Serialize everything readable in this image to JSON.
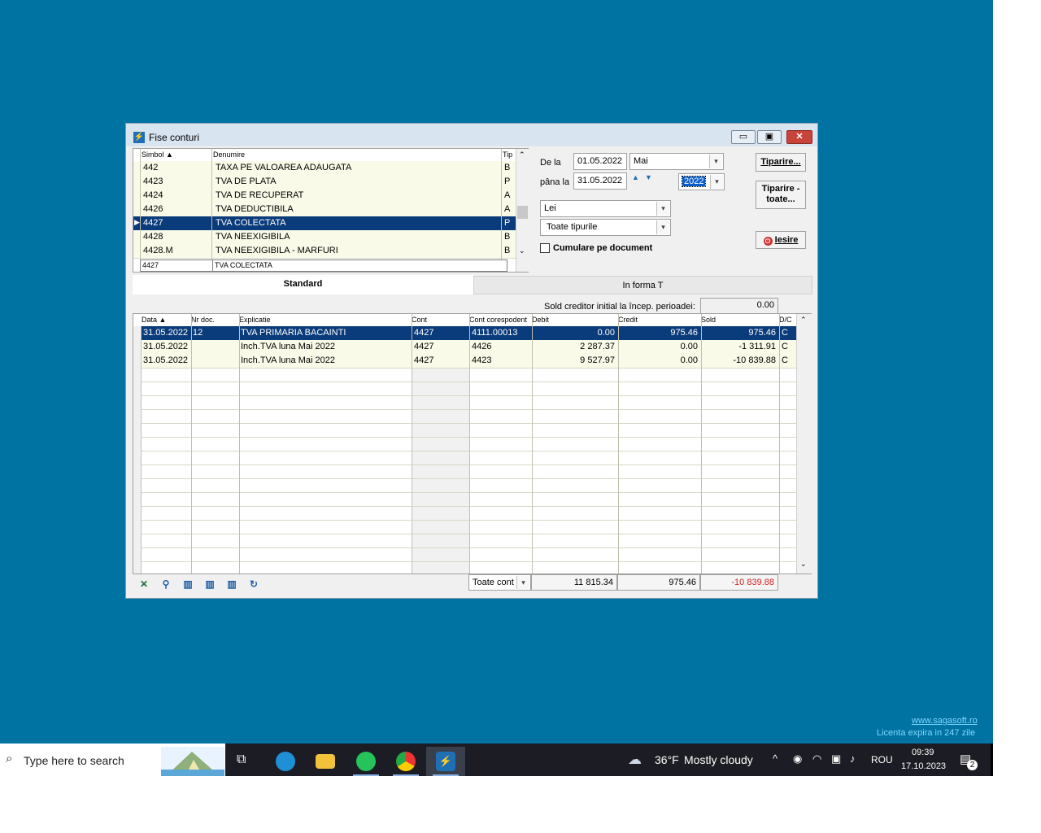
{
  "window": {
    "title": "Fise conturi",
    "minimize_label": "▭",
    "maximize_label": "▣",
    "close_label": "✕"
  },
  "accounts": {
    "headers": {
      "simbol": "Simbol",
      "denumire": "Denumire",
      "tip": "Tip"
    },
    "rows": [
      {
        "simbol": "442",
        "denumire": "TAXA PE VALOAREA ADAUGATA",
        "tip": "B"
      },
      {
        "simbol": "4423",
        "denumire": "TVA DE PLATA",
        "tip": "P"
      },
      {
        "simbol": "4424",
        "denumire": "TVA DE RECUPERAT",
        "tip": "A"
      },
      {
        "simbol": "4426",
        "denumire": "TVA DEDUCTIBILA",
        "tip": "A"
      },
      {
        "simbol": "4427",
        "denumire": "TVA COLECTATA",
        "tip": "P"
      },
      {
        "simbol": "4428",
        "denumire": "TVA NEEXIGIBILA",
        "tip": "B"
      },
      {
        "simbol": "4428.M",
        "denumire": "TVA NEEXIGIBILA - MARFURI",
        "tip": "B"
      }
    ],
    "selected_index": 4,
    "filter": {
      "simbol": "4427",
      "denumire": "TVA COLECTATA"
    }
  },
  "period": {
    "from_label": "De la",
    "from_date": "01.05.2022",
    "month": "Mai",
    "to_label": "pâna la",
    "to_date": "31.05.2022",
    "year": "2022"
  },
  "currency": "Lei",
  "types": "Toate tipurile",
  "cumulare_label": "Cumulare pe document",
  "buttons": {
    "tiparire": "Tiparire...",
    "tiparire_toate_1": "Tiparire -",
    "tiparire_toate_2": "toate...",
    "iesire": "Iesire"
  },
  "tabs": {
    "standard": "Standard",
    "forma_t": "In forma T"
  },
  "sold_initial": {
    "label": "Sold creditor initial la încep. perioadei:",
    "value": "0.00"
  },
  "ledger": {
    "headers": {
      "data": "Data",
      "nr_doc": "Nr doc.",
      "explicatie": "Explicatie",
      "cont": "Cont",
      "cont_corespondent": "Cont corespodent",
      "debit": "Debit",
      "credit": "Credit",
      "sold": "Sold",
      "dc": "D/C"
    },
    "rows": [
      {
        "data": "31.05.2022",
        "nr_doc": "12",
        "explicatie": "TVA PRIMARIA  BACAINTI",
        "cont": "4427",
        "cont_corespondent": "4111.00013",
        "debit": "0.00",
        "credit": "975.46",
        "sold": "975.46",
        "dc": "C"
      },
      {
        "data": "31.05.2022",
        "nr_doc": "",
        "explicatie": "Inch.TVA luna Mai 2022",
        "cont": "4427",
        "cont_corespondent": "4426",
        "debit": "2 287.37",
        "credit": "0.00",
        "sold": "-1 311.91",
        "dc": "C"
      },
      {
        "data": "31.05.2022",
        "nr_doc": "",
        "explicatie": "Inch.TVA luna Mai 2022",
        "cont": "4427",
        "cont_corespondent": "4423",
        "debit": "9 527.97",
        "credit": "0.00",
        "sold": "-10 839.88",
        "dc": "C"
      }
    ]
  },
  "totals": {
    "filter": "Toate cont",
    "debit": "11 815.34",
    "credit": "975.46",
    "sold": "-10 839.88",
    "sold_color": "#d42020"
  },
  "desktop": {
    "site": "www.sagasoft.ro",
    "license": "Licenta expira in 247 zile"
  },
  "taskbar": {
    "search_placeholder": "Type here to search",
    "weather_temp": "36°F",
    "weather_text": "Mostly cloudy",
    "lang": "ROU",
    "time": "09:39",
    "date": "17.10.2023",
    "notifications": "2"
  },
  "colors": {
    "accent": "#0a3b7a",
    "desktop": "#0073a2",
    "row_bg": "#fafae8"
  }
}
